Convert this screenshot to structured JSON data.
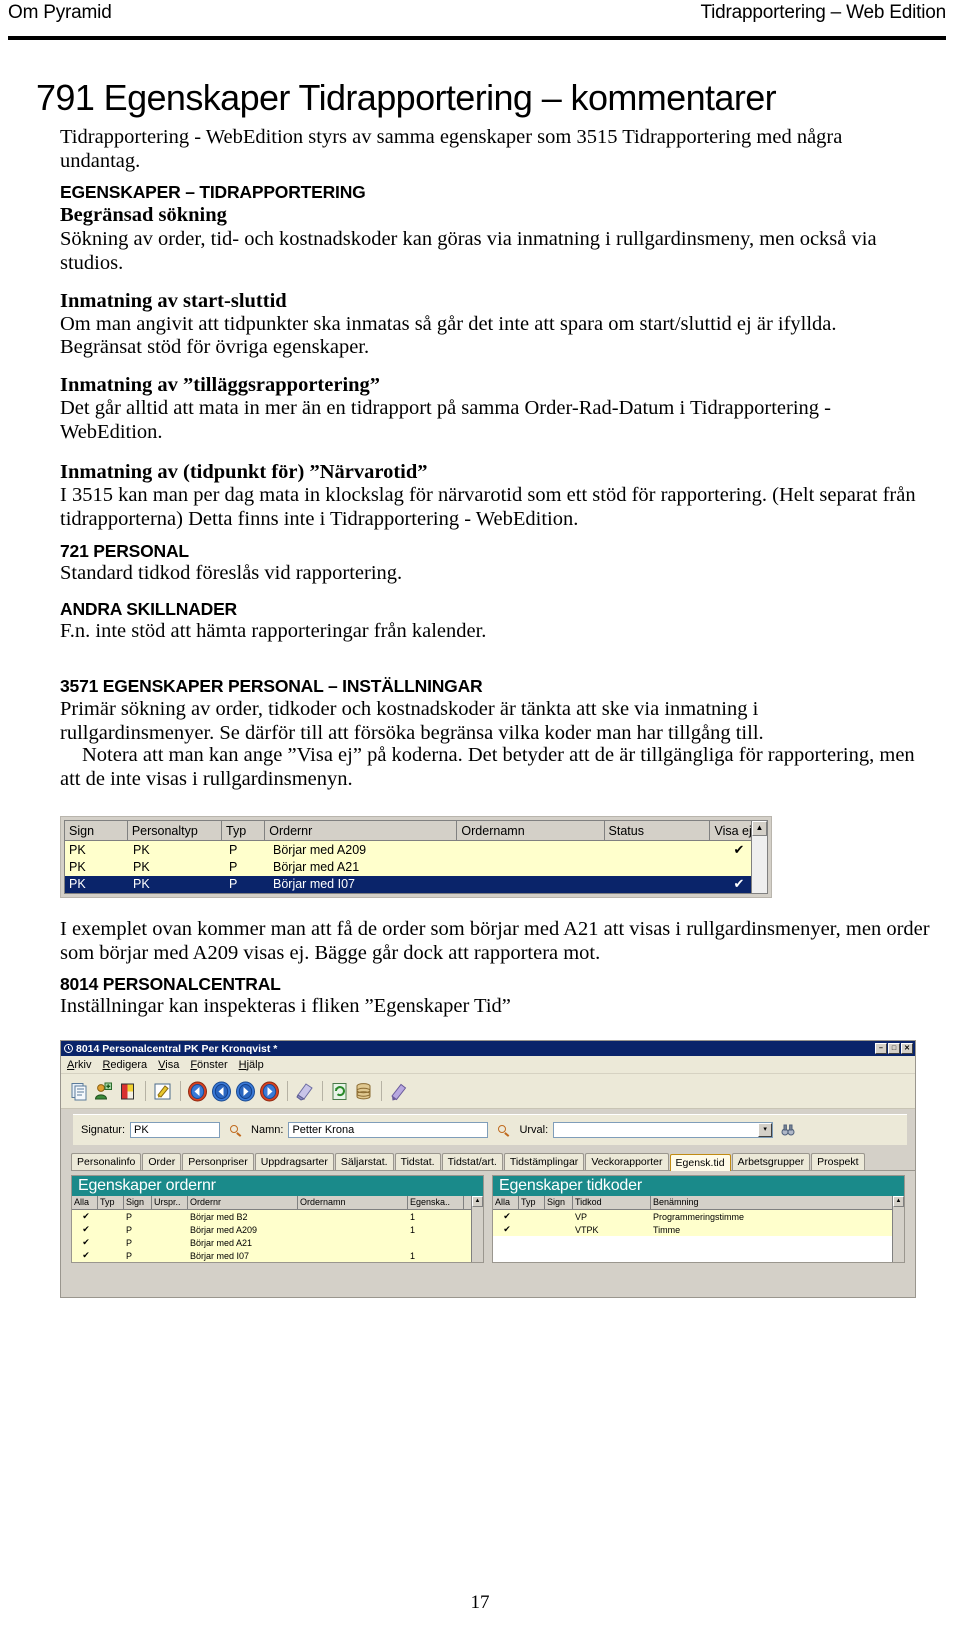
{
  "runhead": {
    "left": "Om Pyramid",
    "right": "Tidrapportering – Web Edition"
  },
  "title": "791 Egenskaper Tidrapportering – kommentarer",
  "intro": "Tidrapportering - WebEdition styrs av samma egenskaper som 3515 Tidrapportering med några undantag.",
  "sections": {
    "s1_head": "EGENSKAPER – TIDRAPPORTERING",
    "s1_sub": "Begränsad sökning",
    "s1_body": "Sökning av order, tid- och kostnadskoder kan göras via inmatning i rullgardinsmeny, men också via studios.",
    "s2_sub": "Inmatning av start-sluttid",
    "s2_body1": "Om man angivit att tidpunkter ska inmatas så går det inte att spara om start/sluttid ej är ifyllda.",
    "s2_body2": "Begränsat stöd för övriga egenskaper.",
    "s3_sub": "Inmatning av ”tilläggsrapportering”",
    "s3_body": "Det går alltid att mata in mer än en tidrapport på samma Order-Rad-Datum i Tidrapportering - WebEdition.",
    "s4_sub": "Inmatning av (tidpunkt för) ”Närvarotid”",
    "s4_body": "I 3515 kan man per dag mata in klockslag för närvarotid som ett stöd för rapportering. (Helt separat från tidrapporterna) Detta finns inte i Tidrapportering - WebEdition.",
    "s5_head": "721 PERSONAL",
    "s5_body": "Standard tidkod föreslås vid rapportering.",
    "s6_head": "ANDRA SKILLNADER",
    "s6_body": "F.n. inte stöd att hämta rapporteringar från kalender.",
    "s7_head": "3571 EGENSKAPER PERSONAL – INSTÄLLNINGAR",
    "s7_body1": "Primär sökning av order, tidkoder och kostnadskoder är tänkta att ske via inmatning i rullgardinsmenyer. Se därför till att försöka begränsa vilka koder man har tillgång till.",
    "s7_body2": "Notera att man kan ange ”Visa ej” på koderna. Det betyder att de är tillgängliga för rapportering, men att de inte visas i rullgardinsmenyn.",
    "after_shot1": "I exemplet ovan kommer man att få de order som börjar med A21 att visas i rullgardinsmenyer, men order som börjar med A209 visas ej. Bägge går dock att rapportera mot.",
    "s8_head": "8014 PERSONALCENTRAL",
    "s8_body": "Inställningar kan inspekteras i fliken ”Egenskaper Tid”"
  },
  "grid1": {
    "columns": [
      "Sign",
      "Personaltyp",
      "Typ",
      "Ordernr",
      "Ordernamn",
      "Status",
      "Visa ej"
    ],
    "rows": [
      {
        "sign": "PK",
        "personaltyp": "PK",
        "typ": "P",
        "ordernr": "Börjar med A209",
        "ordernamn": "",
        "status": "",
        "visa_ej": "✔",
        "state": "yellow"
      },
      {
        "sign": "PK",
        "personaltyp": "PK",
        "typ": "P",
        "ordernr": "Börjar med A21",
        "ordernamn": "",
        "status": "",
        "visa_ej": "",
        "state": "yellow"
      },
      {
        "sign": "PK",
        "personaltyp": "PK",
        "typ": "P",
        "ordernr": "Börjar med I07",
        "ordernamn": "",
        "status": "",
        "visa_ej": "✔",
        "state": "selected"
      }
    ],
    "scroll_up": "▲",
    "scroll_down": "▼"
  },
  "appwin": {
    "title": "8014 Personalcentral PK Per Kronqvist *",
    "title_icon": "clock-icon",
    "buttons": {
      "minimize": "–",
      "maximize": "□",
      "close": "✕"
    },
    "menu": [
      "Arkiv",
      "Redigera",
      "Visa",
      "Fönster",
      "Hjälp"
    ],
    "toolbar_icons": [
      "new-document-icon",
      "add-person-icon",
      "color-card-icon",
      "edit-note-icon",
      "first-arrow-icon",
      "previous-arrow-icon",
      "next-arrow-icon",
      "last-arrow-icon",
      "eraser-icon",
      "refresh-page-icon",
      "database-icon",
      "pencil-icon"
    ],
    "form": {
      "signatur_label": "Signatur:",
      "signatur_value": "PK",
      "namn_label": "Namn:",
      "namn_value": "Petter Krona",
      "urval_label": "Urval:",
      "urval_value": "",
      "lookup_icon": "magnifier-icon",
      "binoculars_icon": "binoculars-icon",
      "dropdown_icon": "chevron-down-icon"
    },
    "tabs": [
      {
        "label": "Personalinfo",
        "active": false
      },
      {
        "label": "Order",
        "active": false
      },
      {
        "label": "Personpriser",
        "active": false
      },
      {
        "label": "Uppdragsarter",
        "active": false
      },
      {
        "label": "Säljarstat.",
        "active": false
      },
      {
        "label": "Tidstat.",
        "active": false
      },
      {
        "label": "Tidstat/art.",
        "active": false
      },
      {
        "label": "Tidstämplingar",
        "active": false
      },
      {
        "label": "Veckorapporter",
        "active": false
      },
      {
        "label": "Egensk.tid",
        "active": true
      },
      {
        "label": "Arbetsgrupper",
        "active": false
      },
      {
        "label": "Prospekt",
        "active": false
      }
    ],
    "panel_left": {
      "title": "Egenskaper ordernr",
      "columns": [
        "Alla",
        "Typ",
        "Sign",
        "Urspr..",
        "Ordernr",
        "Ordernamn",
        "Egenska..",
        ""
      ],
      "rows": [
        {
          "alla": "✔",
          "typ": "",
          "sign": "P",
          "urspr": "",
          "ordernr": "Börjar med B2",
          "ordernamn": "",
          "egenskap": "1"
        },
        {
          "alla": "✔",
          "typ": "",
          "sign": "P",
          "urspr": "",
          "ordernr": "Börjar med A209",
          "ordernamn": "",
          "egenskap": "1"
        },
        {
          "alla": "✔",
          "typ": "",
          "sign": "P",
          "urspr": "",
          "ordernr": "Börjar med A21",
          "ordernamn": "",
          "egenskap": ""
        },
        {
          "alla": "✔",
          "typ": "",
          "sign": "P",
          "urspr": "",
          "ordernr": "Börjar med I07",
          "ordernamn": "",
          "egenskap": "1"
        }
      ]
    },
    "panel_right": {
      "title": "Egenskaper tidkoder",
      "columns": [
        "Alla",
        "Typ",
        "Sign",
        "Tidkod",
        "Benämning",
        ""
      ],
      "rows": [
        {
          "alla": "✔",
          "typ": "",
          "sign": "",
          "tidkod": "VP",
          "benamning": "Programmeringstimme"
        },
        {
          "alla": "✔",
          "typ": "",
          "sign": "",
          "tidkod": "VTPK",
          "benamning": "Timme"
        }
      ]
    },
    "scroll_up": "▲"
  },
  "page_number": "17"
}
